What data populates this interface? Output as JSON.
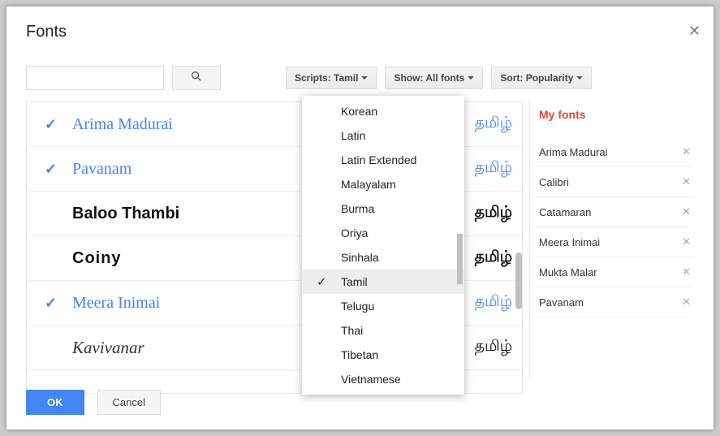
{
  "dialog": {
    "title": "Fonts"
  },
  "toolbar": {
    "search_placeholder": "",
    "scripts_label": "Scripts: Tamil",
    "show_label": "Show: All fonts",
    "sort_label": "Sort: Popularity"
  },
  "fontRows": [
    {
      "name": "Arima Madurai",
      "checked": true,
      "cls": "selected",
      "sample": "தமிழ்",
      "sampleCls": "blue"
    },
    {
      "name": "Pavanam",
      "checked": true,
      "cls": "selected",
      "sample": "தமிழ்",
      "sampleCls": "blue"
    },
    {
      "name": "Baloo Thambi",
      "checked": false,
      "cls": "baloo",
      "sample": "தமிழ்",
      "sampleCls": "bold"
    },
    {
      "name": "Coiny",
      "checked": false,
      "cls": "coiny",
      "sample": "தமிழ்",
      "sampleCls": "bold"
    },
    {
      "name": "Meera Inimai",
      "checked": true,
      "cls": "selected meera",
      "sample": "தமிழ்",
      "sampleCls": "blue"
    },
    {
      "name": "Kavivanar",
      "checked": false,
      "cls": "kaviv",
      "sample": "தமிழ்",
      "sampleCls": ""
    }
  ],
  "dropdown": {
    "items": [
      {
        "label": "Korean",
        "selected": false
      },
      {
        "label": "Latin",
        "selected": false
      },
      {
        "label": "Latin Extended",
        "selected": false
      },
      {
        "label": "Malayalam",
        "selected": false
      },
      {
        "label": "Burma",
        "selected": false
      },
      {
        "label": "Oriya",
        "selected": false
      },
      {
        "label": "Sinhala",
        "selected": false
      },
      {
        "label": "Tamil",
        "selected": true
      },
      {
        "label": "Telugu",
        "selected": false
      },
      {
        "label": "Thai",
        "selected": false
      },
      {
        "label": "Tibetan",
        "selected": false
      },
      {
        "label": "Vietnamese",
        "selected": false
      }
    ]
  },
  "myfonts": {
    "title": "My fonts",
    "items": [
      {
        "name": "Arima Madurai"
      },
      {
        "name": "Calibri"
      },
      {
        "name": "Catamaran"
      },
      {
        "name": "Meera Inimai"
      },
      {
        "name": "Mukta Malar"
      },
      {
        "name": "Pavanam"
      }
    ]
  },
  "footer": {
    "ok": "OK",
    "cancel": "Cancel"
  }
}
